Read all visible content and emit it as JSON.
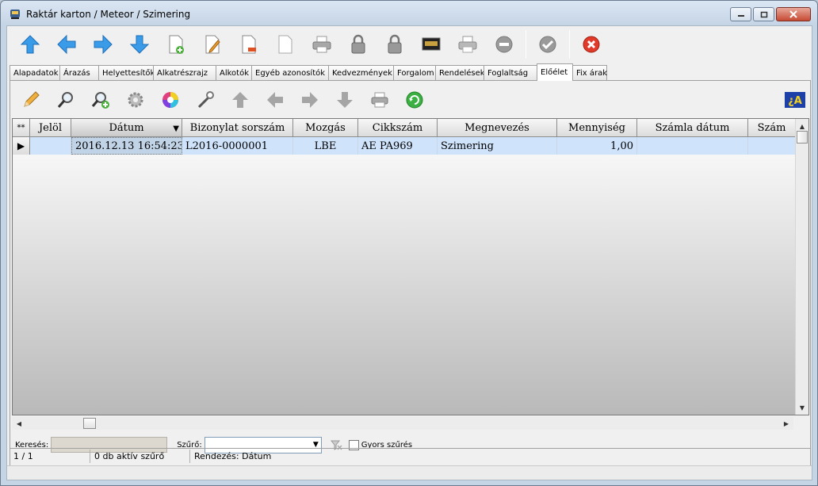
{
  "window": {
    "title": "Raktár karton / Meteor / Szimering"
  },
  "tabs": [
    {
      "label": "Alapadatok",
      "active": false
    },
    {
      "label": "Árazás",
      "active": false
    },
    {
      "label": "Helyettesítők",
      "active": false
    },
    {
      "label": "Alkatrészrajz",
      "active": false
    },
    {
      "label": "Alkotók",
      "active": false
    },
    {
      "label": "Egyéb azonosítók",
      "active": false
    },
    {
      "label": "Kedvezmények",
      "active": false
    },
    {
      "label": "Forgalom",
      "active": false
    },
    {
      "label": "Rendelések",
      "active": false
    },
    {
      "label": "Foglaltság",
      "active": false
    },
    {
      "label": "Előélet",
      "active": true
    },
    {
      "label": "Fix árak",
      "active": false
    }
  ],
  "grid": {
    "indicator_header": "**",
    "columns": [
      "Jelöl",
      "Dátum",
      "Bizonylat sorszám",
      "Mozgás",
      "Cikkszám",
      "Megnevezés",
      "Mennyiség",
      "Számla dátum",
      "Szám"
    ],
    "sorted_column": "Dátum",
    "rows": [
      {
        "indicator": "▶",
        "jelol": "",
        "datum": "2016.12.13 16:54:23",
        "bizonylat": "L2016-0000001",
        "mozgas": "LBE",
        "cikkszam": "AE PA969",
        "megnevezes": "Szimering",
        "mennyiseg": "1,00",
        "szamla_datum": "",
        "szam": ""
      }
    ]
  },
  "search": {
    "label": "Keresés:",
    "value": ""
  },
  "filter": {
    "label": "Szűrő:",
    "value": "",
    "quick_filter_label": "Gyors szűrés",
    "quick_filter_checked": false
  },
  "status": {
    "position": "1 / 1",
    "active_filters": "0 db aktív szűrő",
    "sort": "Rendezés: Dátum"
  },
  "colors": {
    "selected_row": "#cfe3fb",
    "grid_bg_top": "#ffffff",
    "grid_bg_bottom": "#b9b9b9",
    "close_red": "#e03b2a",
    "arrow_blue": "#2f8fe0"
  }
}
